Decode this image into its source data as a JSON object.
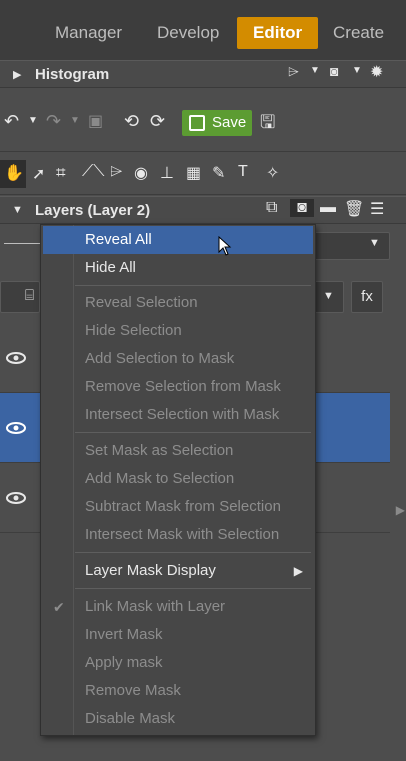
{
  "nav": {
    "tabs": [
      {
        "label": "Manager"
      },
      {
        "label": "Develop"
      },
      {
        "label": "Editor"
      },
      {
        "label": "Create"
      }
    ]
  },
  "histogram": {
    "title": "Histogram"
  },
  "toolbar": {
    "save_label": "Save"
  },
  "layers": {
    "title": "Layers (Layer 2)",
    "fx_label": "fx"
  },
  "menu": {
    "items": [
      {
        "label": "Reveal All"
      },
      {
        "label": "Hide All"
      },
      {
        "label": "Reveal Selection"
      },
      {
        "label": "Hide Selection"
      },
      {
        "label": "Add Selection to Mask"
      },
      {
        "label": "Remove Selection from Mask"
      },
      {
        "label": "Intersect Selection with Mask"
      },
      {
        "label": "Set Mask as Selection"
      },
      {
        "label": "Add Mask to Selection"
      },
      {
        "label": "Subtract Mask from Selection"
      },
      {
        "label": "Intersect Mask with Selection"
      },
      {
        "label": "Layer Mask Display"
      },
      {
        "label": "Link Mask with Layer"
      },
      {
        "label": "Invert Mask"
      },
      {
        "label": "Apply mask"
      },
      {
        "label": "Remove Mask"
      },
      {
        "label": "Disable Mask"
      }
    ]
  },
  "colors": {
    "accent": "#d38c00",
    "highlight": "#3b64a3",
    "save": "#5c9c32"
  }
}
